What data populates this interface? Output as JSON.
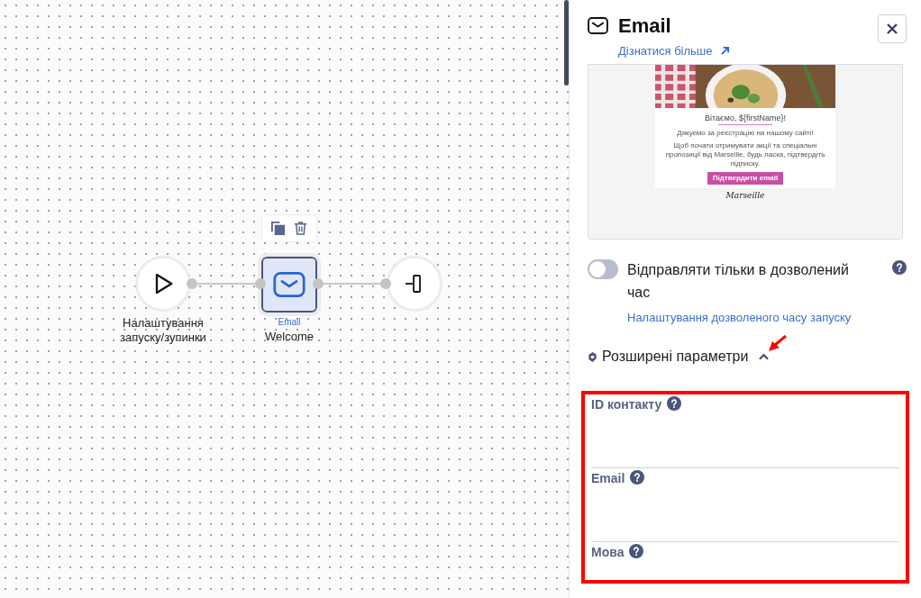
{
  "canvas": {
    "nodes": [
      {
        "kind": "start",
        "label": "Налаштування запуску/зупинки",
        "selected": false
      },
      {
        "kind": "email",
        "type_label": "Email",
        "label": "Welcome",
        "selected": true
      },
      {
        "kind": "exit",
        "selected": false
      }
    ]
  },
  "panel": {
    "title": "Email",
    "learn_more": "Дізнатися більше",
    "preview": {
      "greeting": "Вітаємо, ${firstName}!",
      "thanks": "Дякуємо за реєстрацію на нашому сайті!",
      "body": "Щоб почати отримувати акції та спеціальні пропозиції від Marseille, будь ласка, підтвердіть підписку.",
      "button": "Підтвердити email",
      "signature": "Marseille"
    },
    "allowed_time": {
      "label": "Відправляти тільки в дозволений час",
      "on": false,
      "link": "Налаштування дозволеного часу запуску"
    },
    "advanced": {
      "label": "Розширені параметри",
      "expanded": true,
      "fields": [
        {
          "label": "ID контакту"
        },
        {
          "label": "Email"
        },
        {
          "label": "Мова"
        }
      ]
    }
  }
}
